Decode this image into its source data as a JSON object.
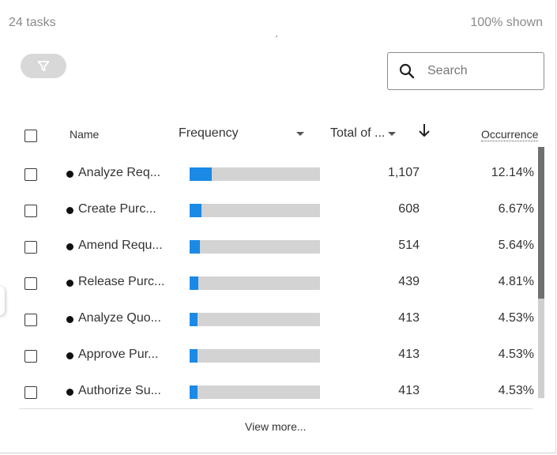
{
  "header": {
    "task_count": "24 tasks",
    "shown": "100% shown"
  },
  "toolbar": {
    "filter_icon": "filter-icon",
    "search_icon": "search-icon",
    "search_placeholder": "Search"
  },
  "table": {
    "columns": {
      "name": "Name",
      "frequency": "Frequency",
      "total": "Total of ...",
      "occurrence": "Occurrence"
    },
    "sort_icon": "arrow-down-icon",
    "accent_color": "#1a8ae6",
    "rows": [
      {
        "name": "Analyze Req...",
        "total": "1,107",
        "occurrence": "12.14%",
        "frequency_fraction": 0.1214
      },
      {
        "name": "Create Purc...",
        "total": "608",
        "occurrence": "6.67%",
        "frequency_fraction": 0.0667
      },
      {
        "name": "Amend Requ...",
        "total": "514",
        "occurrence": "5.64%",
        "frequency_fraction": 0.0564
      },
      {
        "name": "Release Purc...",
        "total": "439",
        "occurrence": "4.81%",
        "frequency_fraction": 0.0481
      },
      {
        "name": "Analyze Quo...",
        "total": "413",
        "occurrence": "4.53%",
        "frequency_fraction": 0.0453
      },
      {
        "name": "Approve Pur...",
        "total": "413",
        "occurrence": "4.53%",
        "frequency_fraction": 0.0453
      },
      {
        "name": "Authorize Su...",
        "total": "413",
        "occurrence": "4.53%",
        "frequency_fraction": 0.0453
      }
    ]
  },
  "footer": {
    "view_more": "View more..."
  }
}
